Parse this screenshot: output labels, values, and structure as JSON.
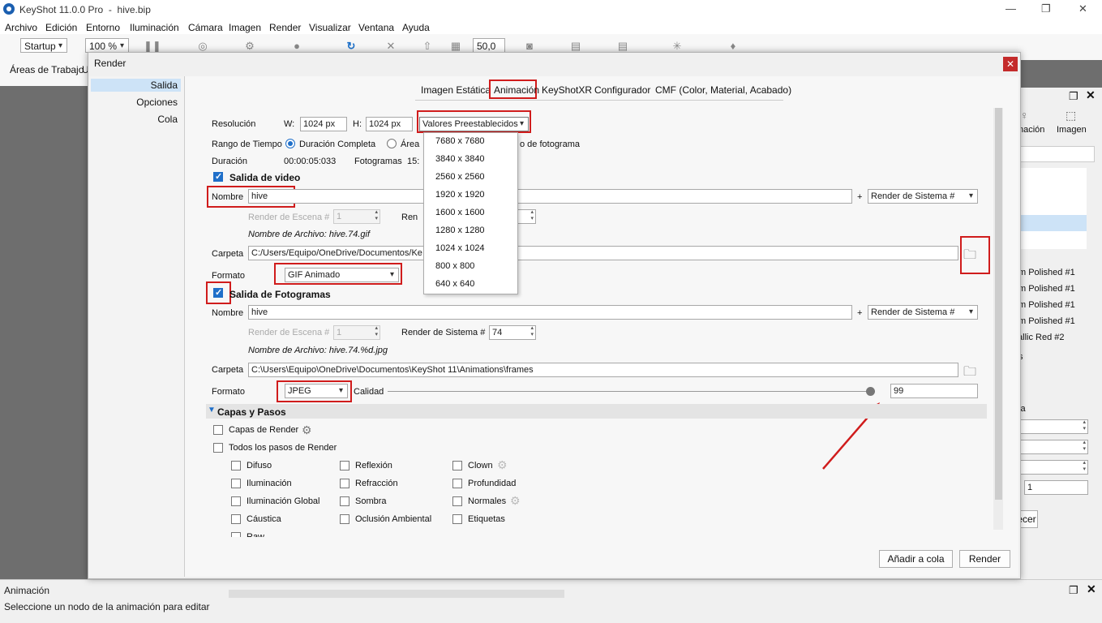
{
  "app": {
    "title": "KeyShot 11.0.0 Pro",
    "file": "hive.bip"
  },
  "window_controls": {
    "minimize": "—",
    "maximize": "❐",
    "close": "✕"
  },
  "menu": [
    "Archivo",
    "Edición",
    "Entorno",
    "Iluminación",
    "Cámara",
    "Imagen",
    "Render",
    "Visualizar",
    "Ventana",
    "Ayuda"
  ],
  "toolbar": {
    "workspace": "Startup",
    "zoom": "100 %",
    "value": "50,0",
    "workspace_label": "Áreas de Trabajo",
    "stub": "U"
  },
  "right_panel": {
    "tab_a": "nación",
    "tab_b": "Imagen",
    "materials": [
      "m Polished #1",
      "m Polished #1",
      "m Polished #1",
      "m Polished #1",
      "tallic Red #2"
    ],
    "label_la": "la",
    "label_s": "s",
    "field_value": "1",
    "button_stub": "ecer"
  },
  "bottom": {
    "title": "Animación",
    "hint": "Seleccione un nodo de la animación para editar"
  },
  "dialog": {
    "title": "Render",
    "nav": [
      "Salida",
      "Opciones",
      "Cola"
    ],
    "tabs": [
      "Imagen Estática",
      "Animación",
      "KeyShotXR",
      "Configurador",
      "CMF (Color, Material, Acabado)"
    ],
    "resolution": {
      "label": "Resolución",
      "w_label": "W:",
      "w_value": "1024 px",
      "h_label": "H:",
      "h_value": "1024 px",
      "preset": "Valores Preestablecidos"
    },
    "presets": [
      "7680 x 7680",
      "3840 x 3840",
      "2560 x 2560",
      "1920 x 1920",
      "1600 x 1600",
      "1280 x 1280",
      "1024 x 1024",
      "800 x 800",
      "640 x 640"
    ],
    "time_range": {
      "label": "Rango de Tiempo",
      "full": "Duración Completa",
      "area": "Área",
      "frame_suffix": "o de fotograma"
    },
    "duration": {
      "label": "Duración",
      "value": "00:00:05:033",
      "frames_label": "Fotogramas",
      "frames_value": "15:"
    },
    "video": {
      "heading": "Salida de video",
      "name_label": "Nombre",
      "name": "hive",
      "plus": "+",
      "system": "Render de Sistema #",
      "scene_label": "Render de Escena #",
      "scene_value": "1",
      "render_stub": "Ren",
      "filename": "Nombre de Archivo: hive.74.gif",
      "folder_label": "Carpeta",
      "folder": "C:/Users/Equipo/OneDrive/Documentos/Ke",
      "format_label": "Formato",
      "format": "GIF Animado"
    },
    "frames": {
      "heading": "Salida de Fotogramas",
      "name_label": "Nombre",
      "name": "hive",
      "plus": "+",
      "system": "Render de Sistema #",
      "scene_label": "Render de Escena #",
      "scene_value": "1",
      "sys_label": "Render de Sistema #",
      "sys_value": "74",
      "filename": "Nombre de Archivo: hive.74.%d.jpg",
      "folder_label": "Carpeta",
      "folder": "C:\\Users\\Equipo\\OneDrive\\Documentos\\KeyShot 11\\Animations\\frames",
      "format_label": "Formato",
      "format": "JPEG",
      "quality_label": "Calidad",
      "quality": "99",
      "quality_fraction": 0.99
    },
    "layers": {
      "heading": "Capas y Pasos",
      "render_layers": "Capas de Render",
      "all_passes": "Todos los pasos de Render",
      "col1": [
        "Difuso",
        "Iluminación",
        "Iluminación Global",
        "Cáustica",
        "Raw"
      ],
      "col2": [
        "Reflexión",
        "Refracción",
        "Sombra",
        "Oclusión Ambiental"
      ],
      "col3": [
        "Clown",
        "Profundidad",
        "Normales",
        "Etiquetas"
      ]
    },
    "buttons": {
      "queue": "Añadir a cola",
      "render": "Render"
    }
  }
}
